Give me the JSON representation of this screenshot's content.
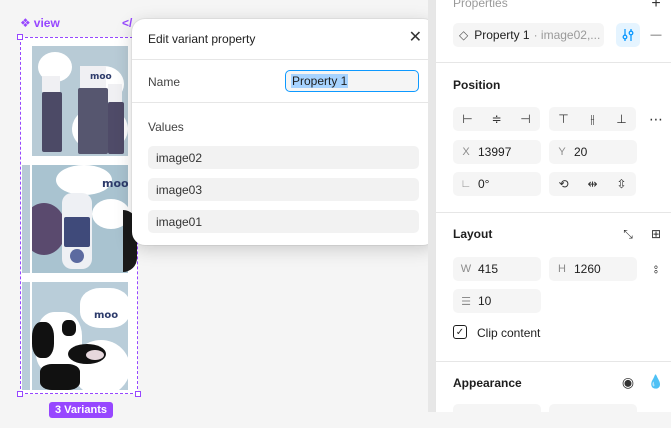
{
  "canvas": {
    "frame_label": "view",
    "frame_glyph": "❖",
    "code_glyph": "</",
    "variants_badge": "3 Variants",
    "thumb_brand": "moo"
  },
  "dialog": {
    "title": "Edit variant property",
    "close_glyph": "✕",
    "name_label": "Name",
    "name_value": "Property 1",
    "values_label": "Values",
    "values": [
      "image02",
      "image03",
      "image01"
    ]
  },
  "panel": {
    "properties_title": "Properties",
    "property_chip": {
      "name": "Property 1",
      "values": "· image02,..."
    },
    "add_glyph": "+",
    "remove_glyph": "—",
    "position_title": "Position",
    "x_label": "X",
    "x_value": "13997",
    "y_label": "Y",
    "y_value": "20",
    "rotation_label": "∟",
    "rotation_value": "0°",
    "layout_title": "Layout",
    "w_label": "W",
    "w_value": "415",
    "h_label": "H",
    "h_value": "1260",
    "gap_value": "10",
    "clip_label": "Clip content",
    "appearance_title": "Appearance"
  },
  "colors": {
    "accent": "#0d99ff",
    "component": "#9747ff"
  }
}
